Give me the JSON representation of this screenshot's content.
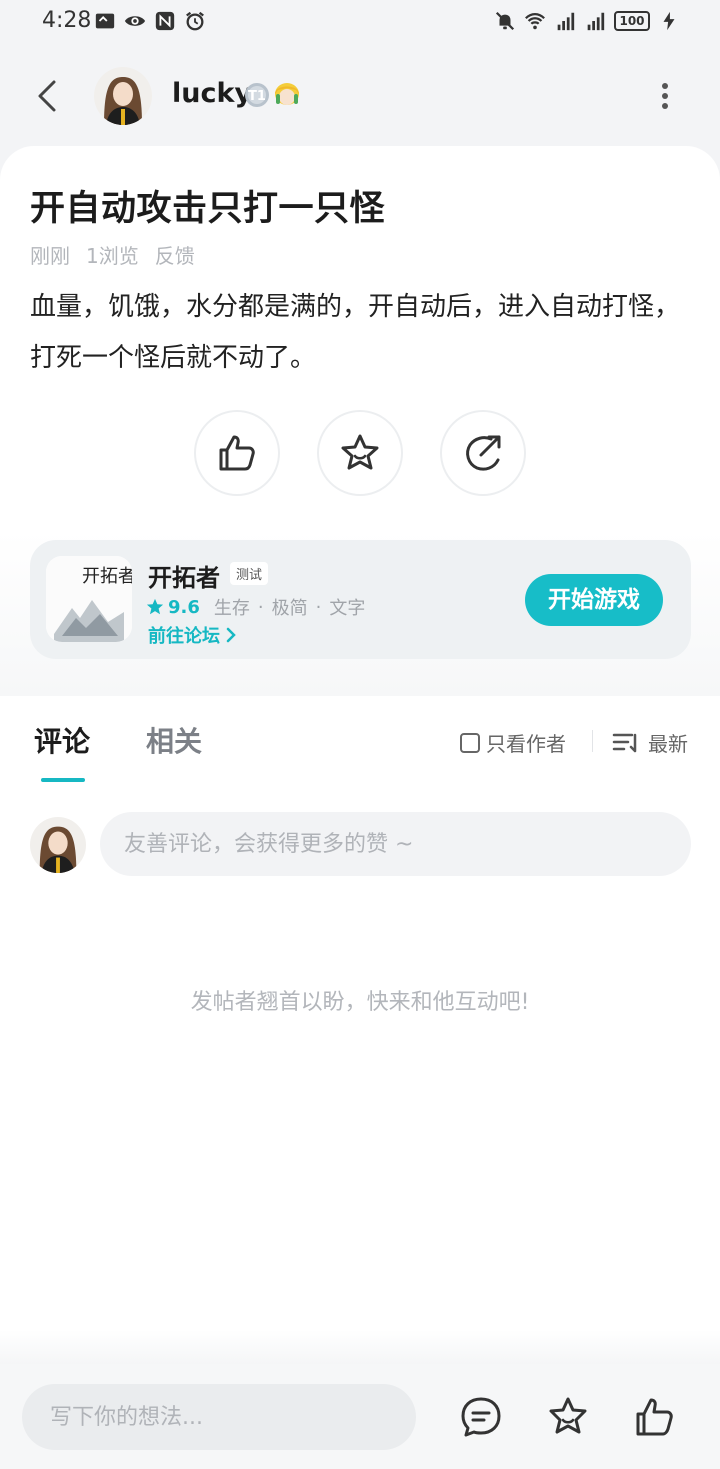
{
  "status_bar": {
    "time": "4:28",
    "battery": "100"
  },
  "header": {
    "username": "lucky",
    "badge_level": "T1"
  },
  "post": {
    "title": "开自动攻击只打一只怪",
    "meta": [
      "刚刚",
      "1浏览",
      "反馈"
    ],
    "body": "血量，饥饿，水分都是满的，开自动后，进入自动打怪，打死一个怪后就不动了。"
  },
  "game": {
    "name": "开拓者",
    "tag": "测试",
    "logo_text": "开拓者",
    "rating": "9.6",
    "genres": [
      "生存",
      "极简",
      "文字"
    ],
    "forum_link": "前往论坛",
    "start_button": "开始游戏"
  },
  "comments": {
    "tabs": [
      "评论",
      "相关"
    ],
    "author_only_label": "只看作者",
    "sort_label": "最新",
    "input_placeholder": "友善评论，会获得更多的赞 ~",
    "empty_hint": "发帖者翘首以盼，快来和他互动吧!"
  },
  "bottom_bar": {
    "input_placeholder": "写下你的想法..."
  },
  "colors": {
    "accent": "#16b8c3",
    "background": "#f3f4f6"
  },
  "icons": [
    "back-arrow-icon",
    "more-vertical-icon",
    "like-icon",
    "star-icon",
    "share-icon",
    "chevron-right-icon",
    "sort-icon",
    "comment-icon"
  ]
}
